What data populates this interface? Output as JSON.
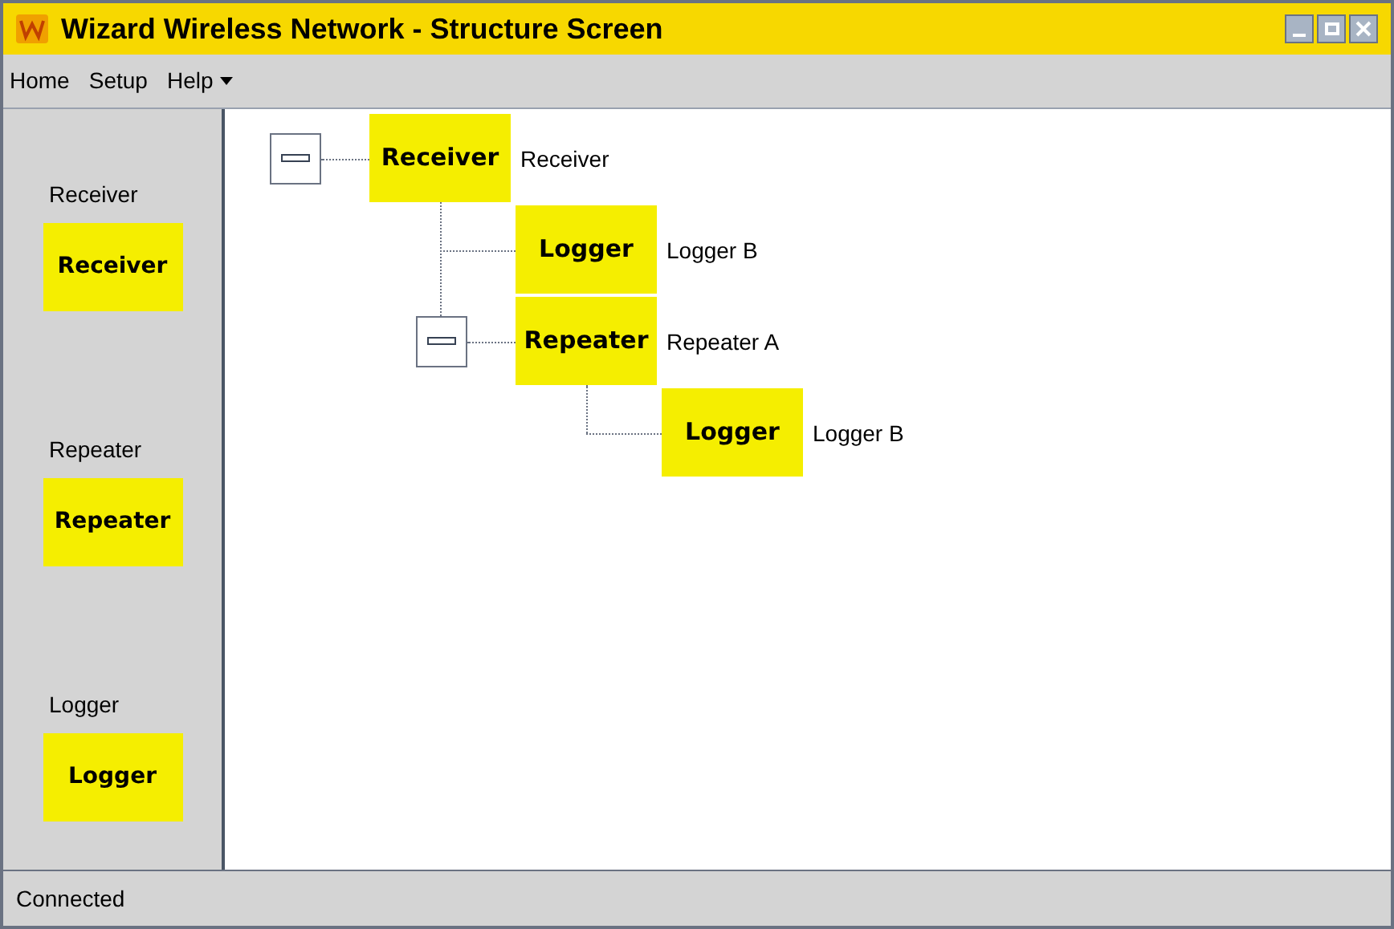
{
  "window": {
    "title": "Wizard Wireless Network - Structure Screen"
  },
  "menu": [
    {
      "label": "Home",
      "dropdown": false
    },
    {
      "label": "Setup",
      "dropdown": false
    },
    {
      "label": "Help",
      "dropdown": true
    }
  ],
  "palette": [
    {
      "label": "Receiver",
      "tile": "Receiver"
    },
    {
      "label": "Repeater",
      "tile": "Repeater"
    },
    {
      "label": "Logger",
      "tile": "Logger"
    }
  ],
  "tree": [
    {
      "tile": "Receiver",
      "name": "Receiver",
      "expanded": true,
      "children": [
        {
          "tile": "Logger",
          "name": "Logger B"
        },
        {
          "tile": "Repeater",
          "name": "Repeater A",
          "expanded": true,
          "children": [
            {
              "tile": "Logger",
              "name": "Logger B"
            }
          ]
        }
      ]
    }
  ],
  "status_bar": "Connected"
}
